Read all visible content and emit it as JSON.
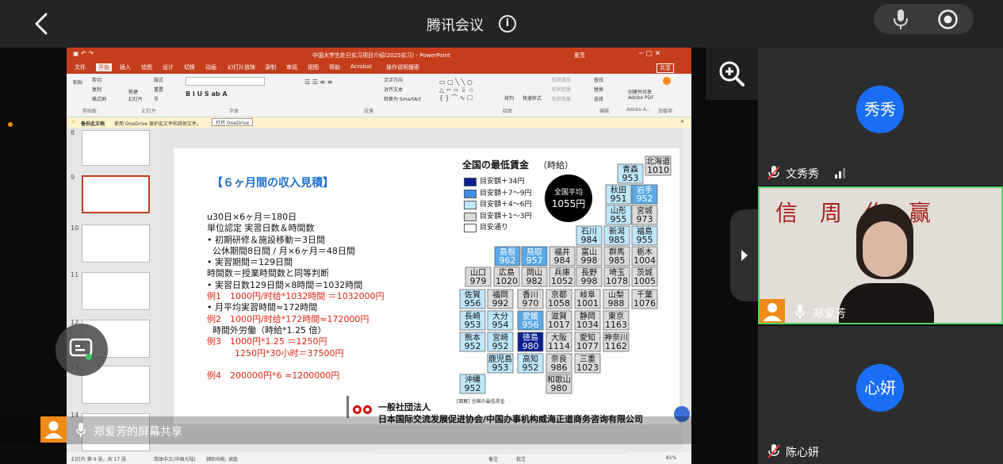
{
  "header": {
    "title": "腾讯会议"
  },
  "ppt": {
    "window_title": "中国大学生赴日实习项目介绍(2025实习) - PowerPoint",
    "user": "爱芳",
    "tabs": [
      "文件",
      "开始",
      "插入",
      "绘图",
      "设计",
      "切换",
      "动画",
      "幻灯片放映",
      "录制",
      "审阅",
      "视图",
      "帮助",
      "Acrobat",
      "操作说明搜索"
    ],
    "share_btn": "共享",
    "ribbon": {
      "paste": "粘贴",
      "cut": "剪切",
      "copy": "复制",
      "format_painter": "格式刷",
      "clipboard": "剪贴板",
      "new_slide": "新建\n幻灯片",
      "layout": "版式",
      "reset": "重置",
      "section": "节",
      "slides": "幻灯片",
      "font": "字体",
      "paragraph": "段落",
      "text_direction": "文字方向",
      "align_text": "对齐文本",
      "smartart": "转换为 SmartArt",
      "drawing": "绘图",
      "arrange": "排列",
      "quick_styles": "快速样式",
      "shape_fill": "形状填充",
      "shape_outline": "形状轮廓",
      "shape_effects": "形状效果",
      "find": "查找",
      "replace": "替换",
      "select": "选择",
      "editing": "编辑",
      "acrobat": "创建并共享\nAdobe PDF",
      "adobe": "Adobe A...",
      "addins": "加载项"
    },
    "notice": {
      "label": "备份此文档",
      "text": "使用 OneDrive 保护此文件和其他文件。",
      "button": "打开 OneDrive"
    },
    "thumb_numbers": [
      "8",
      "9",
      "10",
      "11",
      "12",
      "13",
      "14"
    ],
    "status": "幻灯片 第 9 张，共 17 张",
    "lang": "简体中文(中国大陆)",
    "accessibility": "辅助功能: 调查",
    "notes": "备注",
    "comments": "批注",
    "zoom": "81%"
  },
  "slide": {
    "heading": "【６ヶ月間の収入見積】",
    "lines": [
      {
        "text": "u30日×6ヶ月＝180日",
        "color": "#111"
      },
      {
        "text": "単位認定 実習日数＆時間数",
        "color": "#111"
      },
      {
        "text": "• 初期研修＆施設移動＝3日間",
        "color": "#111"
      },
      {
        "text": "  公休期間8日間 / 月×6ヶ月＝48日間",
        "color": "#111"
      },
      {
        "text": "• 実習期間＝129日間",
        "color": "#111"
      },
      {
        "text": "時間数＝授業時間数と同等判断",
        "color": "#111"
      },
      {
        "text": "• 実習日数129日間×8時間＝1032時間",
        "color": "#111"
      },
      {
        "text": "例1　1000円/时给*1032時間 ＝1032000円",
        "color": "#e32414"
      },
      {
        "text": "• 月平均実習時間≈172時間",
        "color": "#111"
      },
      {
        "text": "例2　1000円/时给*172時間≈172000円",
        "color": "#e32414"
      },
      {
        "text": "  時間外労働（時給*1.25 倍）",
        "color": "#111"
      },
      {
        "text": "例3　1000円*1.25 ＝1250円",
        "color": "#e32414"
      },
      {
        "text": "          1250円*30小时＝37500円",
        "color": "#e32414"
      },
      {
        "text": "",
        "color": "#111"
      },
      {
        "text": "例4　200000円*6 ≈1200000円",
        "color": "#e32414"
      }
    ],
    "map_title": "全国の最低賃金",
    "map_sub": "（時給）",
    "avg_label": "全国平均",
    "avg_value": "1055円",
    "legend": [
      "目安額＋34円",
      "目安額＋7～9円",
      "目安額＋4～6円",
      "目安額＋1～3円",
      "目安通り"
    ],
    "source": "[図解] 全国の最低賃金",
    "org1": "一般社団法人",
    "org2": "日本国际交流发展促进协会/中国办事机构威海正道商务咨询有限公司",
    "prefs": [
      {
        "n": "北海道",
        "v": "1010",
        "c": 0
      },
      {
        "n": "青森",
        "v": "953",
        "c": 1
      },
      {
        "n": "秋田",
        "v": "951",
        "c": 1
      },
      {
        "n": "岩手",
        "v": "952",
        "c": 2
      },
      {
        "n": "山形",
        "v": "955",
        "c": 1
      },
      {
        "n": "宮城",
        "v": "973",
        "c": 0
      },
      {
        "n": "石川",
        "v": "984",
        "c": 1
      },
      {
        "n": "新潟",
        "v": "985",
        "c": 1
      },
      {
        "n": "福島",
        "v": "955",
        "c": 1
      },
      {
        "n": "島根",
        "v": "962",
        "c": 2
      },
      {
        "n": "鳥取",
        "v": "957",
        "c": 2
      },
      {
        "n": "福井",
        "v": "984",
        "c": 0
      },
      {
        "n": "富山",
        "v": "998",
        "c": 0
      },
      {
        "n": "群馬",
        "v": "985",
        "c": 0
      },
      {
        "n": "栃木",
        "v": "1004",
        "c": 0
      },
      {
        "n": "山口",
        "v": "979",
        "c": 0
      },
      {
        "n": "広島",
        "v": "1020",
        "c": 0
      },
      {
        "n": "岡山",
        "v": "982",
        "c": 0
      },
      {
        "n": "兵庫",
        "v": "1052",
        "c": 0
      },
      {
        "n": "長野",
        "v": "998",
        "c": 0
      },
      {
        "n": "埼玉",
        "v": "1078",
        "c": 0
      },
      {
        "n": "茨城",
        "v": "1005",
        "c": 0
      },
      {
        "n": "佐賀",
        "v": "956",
        "c": 1
      },
      {
        "n": "福岡",
        "v": "992",
        "c": 0
      },
      {
        "n": "香川",
        "v": "970",
        "c": 0
      },
      {
        "n": "京都",
        "v": "1058",
        "c": 0
      },
      {
        "n": "岐阜",
        "v": "1001",
        "c": 0
      },
      {
        "n": "山梨",
        "v": "988",
        "c": 0
      },
      {
        "n": "千葉",
        "v": "1076",
        "c": 0
      },
      {
        "n": "長崎",
        "v": "953",
        "c": 1
      },
      {
        "n": "大分",
        "v": "954",
        "c": 1
      },
      {
        "n": "愛媛",
        "v": "956",
        "c": 2
      },
      {
        "n": "滋賀",
        "v": "1017",
        "c": 0
      },
      {
        "n": "静岡",
        "v": "1034",
        "c": 0
      },
      {
        "n": "東京",
        "v": "1163",
        "c": 0
      },
      {
        "n": "熊本",
        "v": "952",
        "c": 1
      },
      {
        "n": "宮崎",
        "v": "952",
        "c": 1
      },
      {
        "n": "徳島",
        "v": "980",
        "c": 4
      },
      {
        "n": "大阪",
        "v": "1114",
        "c": 0
      },
      {
        "n": "愛知",
        "v": "1077",
        "c": 0
      },
      {
        "n": "神奈川",
        "v": "1162",
        "c": 0
      },
      {
        "n": "鹿児島",
        "v": "953",
        "c": 1
      },
      {
        "n": "高知",
        "v": "952",
        "c": 1
      },
      {
        "n": "奈良",
        "v": "986",
        "c": 0
      },
      {
        "n": "三重",
        "v": "1023",
        "c": 0
      },
      {
        "n": "和歌山",
        "v": "980",
        "c": 0
      },
      {
        "n": "沖縄",
        "v": "952",
        "c": 1
      }
    ]
  },
  "sharer": {
    "label": "郑爱芳的屏幕共享"
  },
  "participants": [
    {
      "avatar": "秀秀",
      "name": "文秀秀"
    },
    {
      "name": "郑爱芳"
    },
    {
      "avatar": "心妍",
      "name": "陈心妍"
    }
  ],
  "colors": {
    "topbar": "#232426",
    "accent_blue": "#1a6ef5",
    "ppt_red": "#c43e1c"
  }
}
